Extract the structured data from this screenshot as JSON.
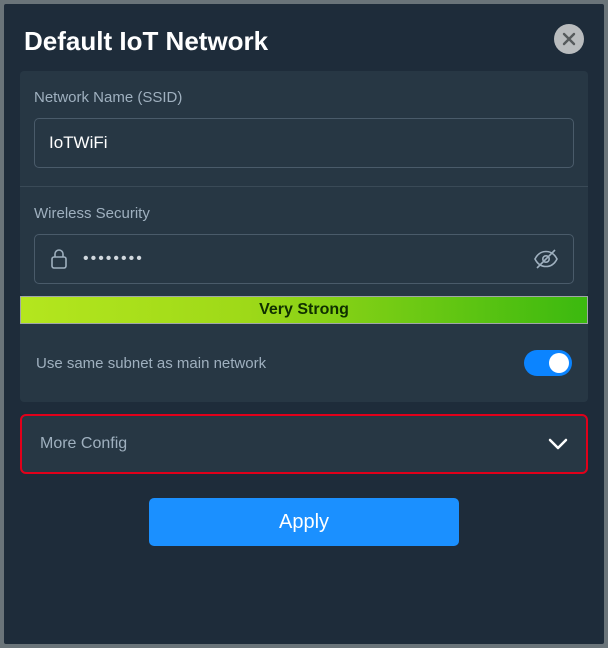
{
  "header": {
    "title": "Default IoT Network"
  },
  "network": {
    "ssid_label": "Network Name (SSID)",
    "ssid_value": "IoTWiFi"
  },
  "security": {
    "label": "Wireless Security",
    "password_mask": "••••••••",
    "strength_label": "Very Strong"
  },
  "subnet": {
    "label": "Use same subnet as main network",
    "on": true
  },
  "more": {
    "label": "More Config"
  },
  "actions": {
    "apply": "Apply"
  }
}
